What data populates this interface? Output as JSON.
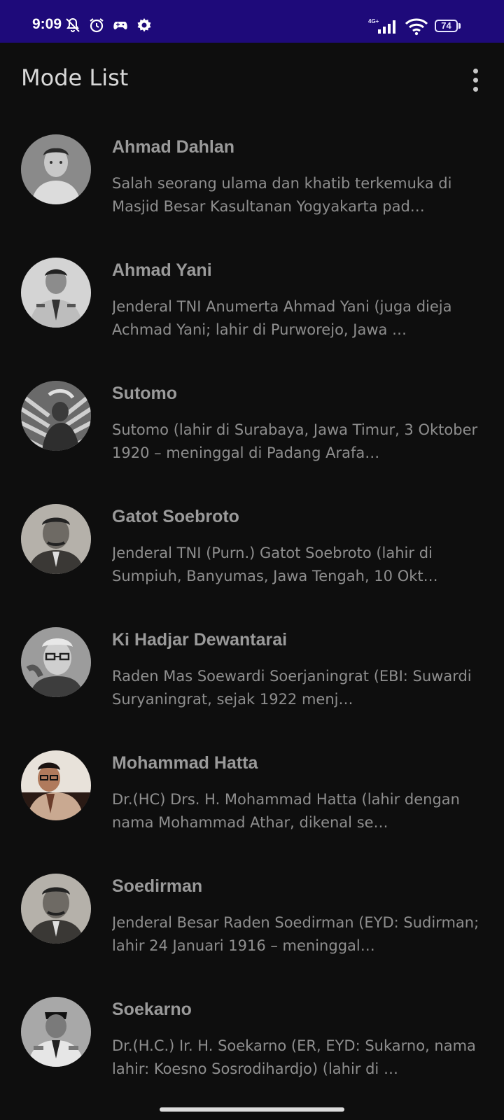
{
  "status_bar": {
    "time": "9:09",
    "network_type": "4G+",
    "battery_level": "74",
    "icons": [
      "notifications-off-icon",
      "alarm-icon",
      "game-controller-icon",
      "settings-icon",
      "signal-icon",
      "wifi-icon",
      "battery-icon"
    ]
  },
  "app_bar": {
    "title": "Mode List",
    "menu_icon": "overflow-menu-icon"
  },
  "heroes": [
    {
      "name": "Ahmad Dahlan",
      "description": "Salah seorang ulama dan khatib terkemuka di Masjid Besar Kasultanan Yogyakarta pad…"
    },
    {
      "name": "Ahmad Yani",
      "description": "Jenderal TNI Anumerta Ahmad Yani (juga dieja Achmad Yani; lahir di Purworejo, Jawa …"
    },
    {
      "name": "Sutomo",
      "description": "Sutomo (lahir di Surabaya, Jawa Timur, 3 Oktober 1920 – meninggal di Padang Arafa…"
    },
    {
      "name": "Gatot Soebroto",
      "description": "Jenderal TNI (Purn.) Gatot Soebroto (lahir di Sumpiuh, Banyumas, Jawa Tengah, 10 Okt…"
    },
    {
      "name": "Ki Hadjar Dewantarai",
      "description": "Raden Mas Soewardi Soerjaningrat (EBI: Suwardi Suryaningrat, sejak 1922 menj…"
    },
    {
      "name": "Mohammad Hatta",
      "description": "Dr.(HC) Drs. H. Mohammad Hatta (lahir dengan nama Mohammad Athar, dikenal se…"
    },
    {
      "name": "Soedirman",
      "description": "Jenderal Besar Raden Soedirman (EYD: Sudirman; lahir 24 Januari 1916 – meninggal…"
    },
    {
      "name": "Soekarno",
      "description": "Dr.(H.C.) Ir. H. Soekarno (ER, EYD: Sukarno, nama lahir: Koesno Sosrodihardjo) (lahir di …"
    }
  ],
  "colors": {
    "status_bar": "#1e0a7a",
    "background": "#0e0e0e",
    "title_text": "#d8d8d8",
    "name_text": "#9a9a9a",
    "description_text": "#8e8e8e"
  }
}
